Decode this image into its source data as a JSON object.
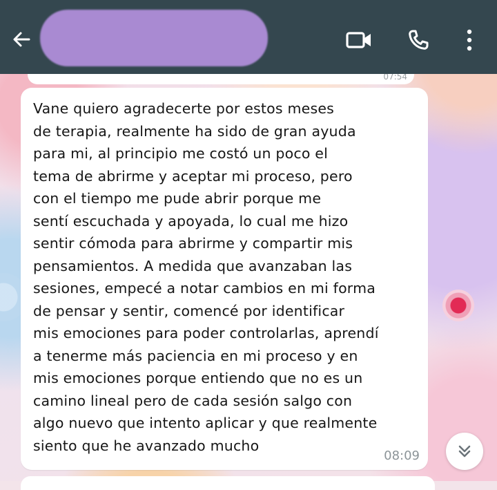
{
  "header": {
    "back_icon": "arrow-left-icon",
    "contact_name_redacted": true,
    "icons": [
      "video-camera-icon",
      "phone-icon",
      "more-vertical-icon"
    ],
    "background_color": "#34474f",
    "icon_color": "#ffffff",
    "redaction_color": "#a98ad2"
  },
  "previous_message": {
    "time": "07:54"
  },
  "message": {
    "lines": [
      "Vane quiero agradecerte por estos meses",
      "de terapia, realmente ha sido de gran ayuda",
      "para mi, al principio me costó un poco el",
      "tema de abrirme y aceptar mi proceso, pero",
      "con el tiempo me pude abrir porque me",
      "sentí escuchada y apoyada, lo cual me hizo",
      "sentir cómoda para abrirme y compartir mis",
      "pensamientos. A medida que avanzaban las",
      "sesiones, empecé a notar cambios en mi forma",
      "de pensar y sentir, comencé por identificar",
      "mis emociones para poder controlarlas, aprendí",
      "a tenerme más paciencia en mi proceso y en",
      "mis emociones porque entiendo que no es un",
      "camino lineal pero de cada sesión salgo con",
      "algo nuevo que intento aplicar y que realmente",
      "siento que he avanzado mucho"
    ],
    "time": "08:09",
    "bubble_color": "#ffffff"
  },
  "scroll_button": {
    "icon": "double-chevron-down-icon"
  }
}
